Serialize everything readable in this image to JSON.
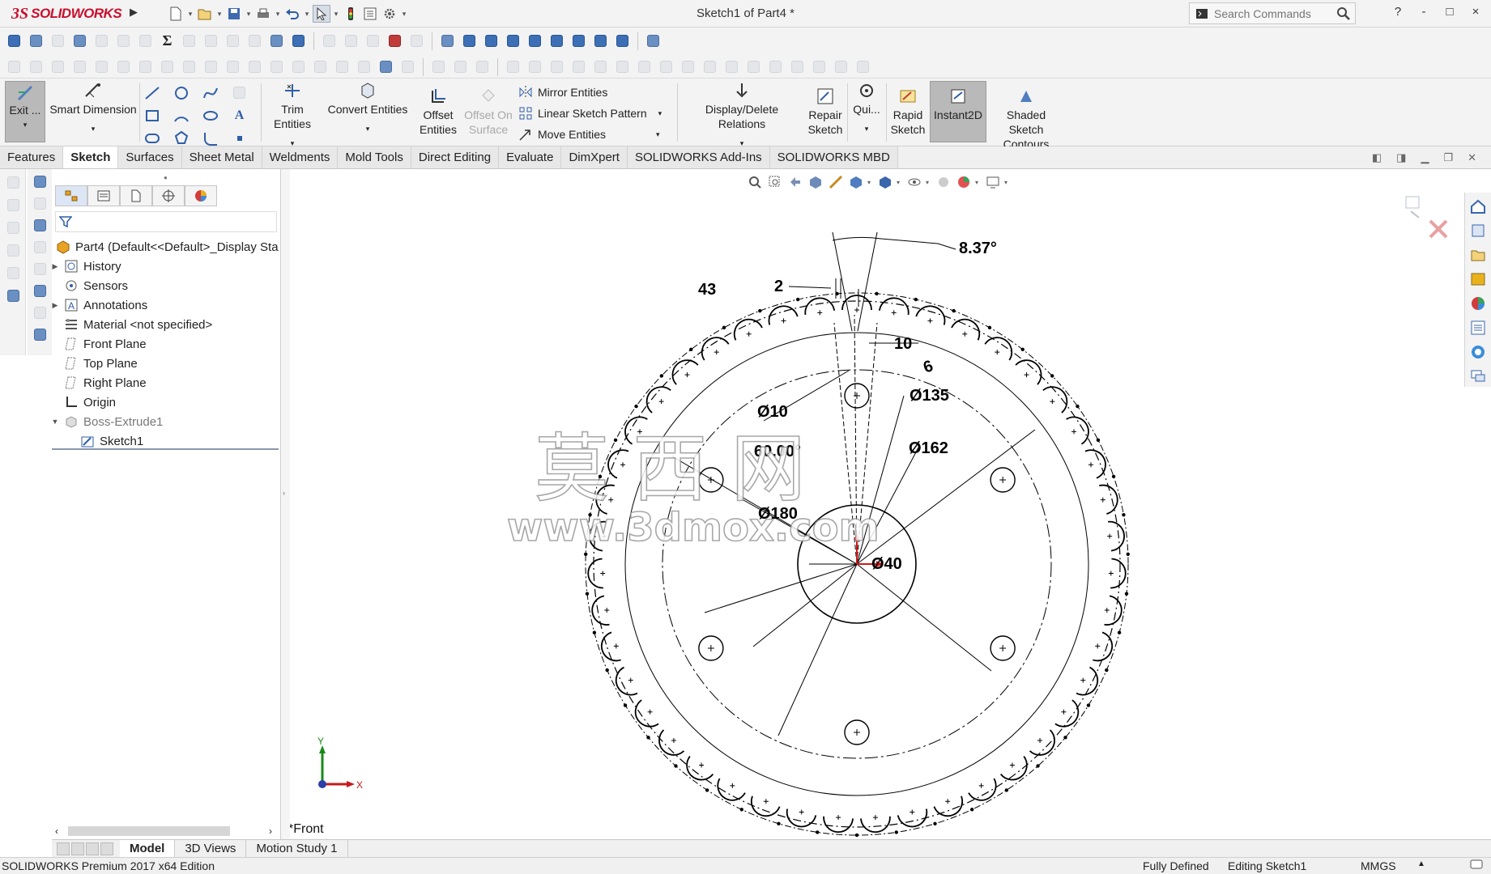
{
  "app": {
    "brand_ds": "3S",
    "brand_name": "SOLIDWORKS",
    "document_title": "Sketch1 of Part4 *"
  },
  "search": {
    "placeholder": "Search Commands"
  },
  "window_controls": [
    "?",
    "-",
    "□",
    "×"
  ],
  "command_manager": {
    "exit": "Exit ...",
    "smart_dimension": "Smart Dimension",
    "trim_entities": "Trim Entities",
    "convert_entities": "Convert Entities",
    "offset_entities_l1": "Offset",
    "offset_entities_l2": "Entities",
    "offset_on_surface_l1": "Offset On",
    "offset_on_surface_l2": "Surface",
    "mirror_entities": "Mirror Entities",
    "linear_sketch_pattern": "Linear Sketch Pattern",
    "move_entities": "Move Entities",
    "display_delete_relations": "Display/Delete Relations",
    "repair_sketch_l1": "Repair",
    "repair_sketch_l2": "Sketch",
    "quick_snaps": "Qui...",
    "rapid_sketch_l1": "Rapid",
    "rapid_sketch_l2": "Sketch",
    "instant2d": "Instant2D",
    "shaded_contours_l1": "Shaded Sketch",
    "shaded_contours_l2": "Contours"
  },
  "tabs": [
    "Features",
    "Sketch",
    "Surfaces",
    "Sheet Metal",
    "Weldments",
    "Mold Tools",
    "Direct Editing",
    "Evaluate",
    "DimXpert",
    "SOLIDWORKS Add-Ins",
    "SOLIDWORKS MBD"
  ],
  "active_tab": "Sketch",
  "tree": {
    "root": "Part4  (Default<<Default>_Display Sta",
    "history": "History",
    "sensors": "Sensors",
    "annotations": "Annotations",
    "material": "Material <not specified>",
    "front_plane": "Front Plane",
    "top_plane": "Top Plane",
    "right_plane": "Right Plane",
    "origin": "Origin",
    "boss_extrude": "Boss-Extrude1",
    "sketch": "Sketch1"
  },
  "dimensions": {
    "angle_small": "8.37°",
    "width_2": "2",
    "count_43": "43",
    "dim_10": "10",
    "dia_10": "Ø10",
    "dia_135": "Ø135",
    "num_6": "6",
    "angle_60": "60.00°",
    "dia_162": "Ø162",
    "dia_180": "Ø180",
    "dia_40": "Ø40"
  },
  "watermark": {
    "line1": "莫 西 网",
    "line2": "www.3dmox.com"
  },
  "triad": {
    "x": "X",
    "y": "Y"
  },
  "view_label": "*Front",
  "bottom_tabs": [
    "Model",
    "3D Views",
    "Motion Study 1"
  ],
  "status": {
    "edition": "SOLIDWORKS Premium 2017 x64 Edition",
    "defined": "Fully Defined",
    "editing": "Editing Sketch1",
    "units": "MMGS"
  },
  "colors": {
    "brand": "#c8102e",
    "active_tab": "#ffffff",
    "sketch_line": "#000000",
    "origin_red": "#d01818"
  }
}
